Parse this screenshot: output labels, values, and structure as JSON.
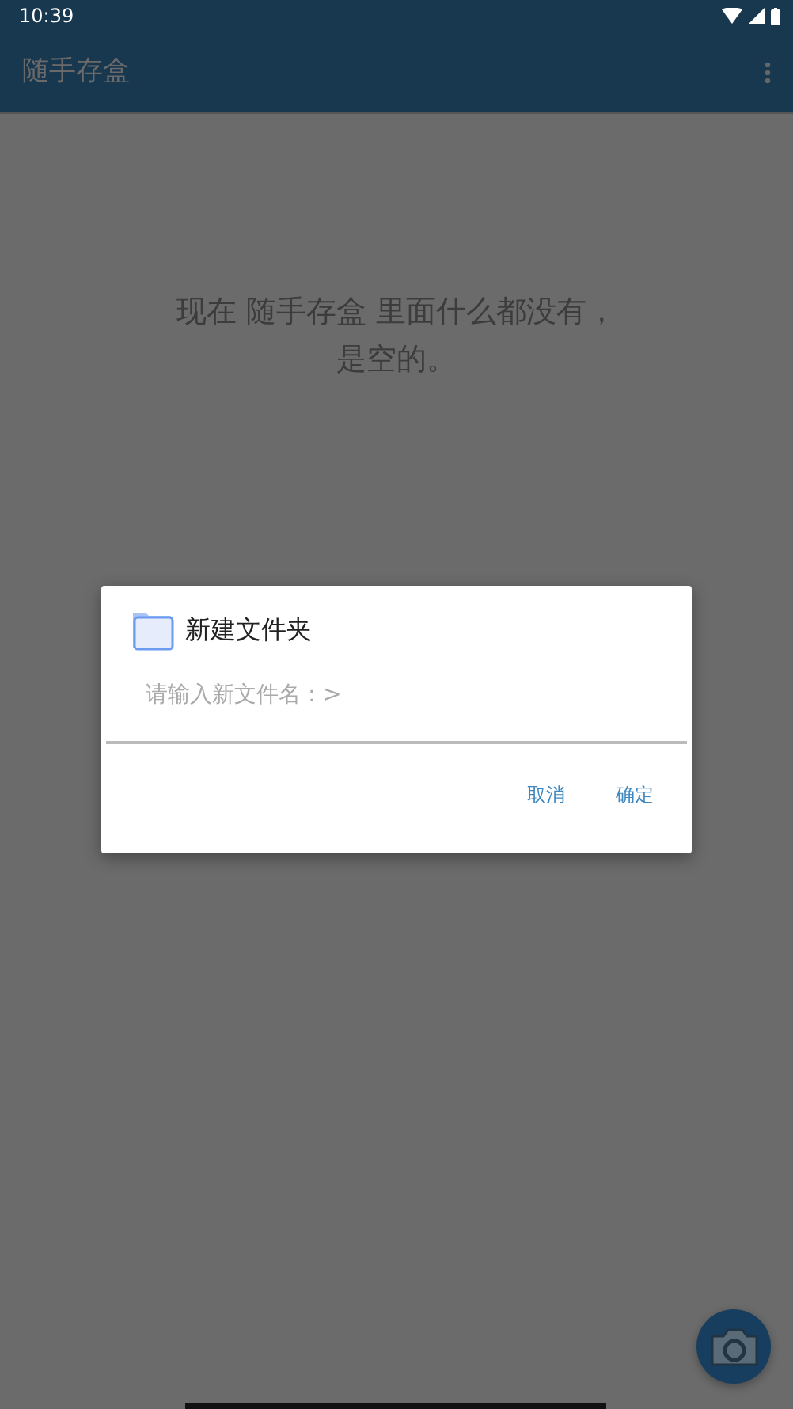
{
  "status_bar": {
    "time": "10:39"
  },
  "app_bar": {
    "title": "随手存盒"
  },
  "empty_message": {
    "lines": [
      "现在 随手存盒 里面什么都没有，",
      "是空的。"
    ]
  },
  "dialog": {
    "title": "新建文件夹",
    "input": {
      "placeholder": "请输入新文件名：>"
    },
    "buttons": [
      {
        "label": "取消"
      },
      {
        "label": "确定"
      }
    ]
  }
}
